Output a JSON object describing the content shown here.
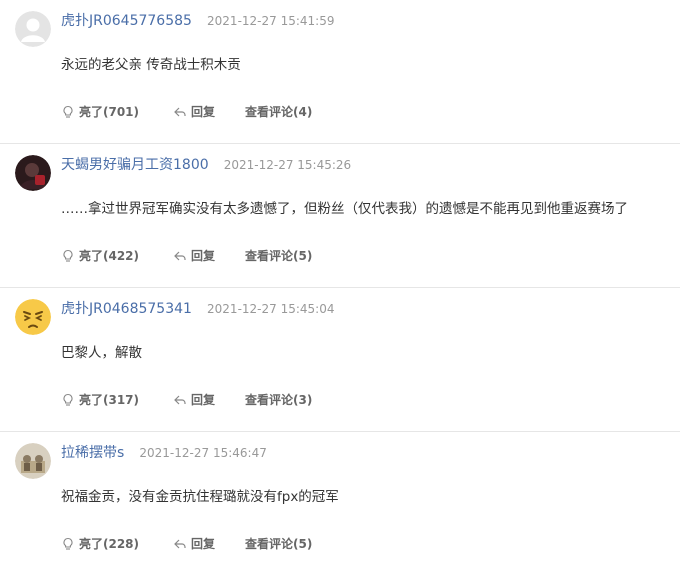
{
  "comments": [
    {
      "username": "虎扑JR0645776585",
      "time": "2021-12-27 15:41:59",
      "content": "永远的老父亲 传奇战士积木贡",
      "like_label": "亮了(701)",
      "reply_label": "回复",
      "view_replies_label": "查看评论(4)",
      "avatar": "default-avatar"
    },
    {
      "username": "天蝎男好骗月工资1800",
      "time": "2021-12-27 15:45:26",
      "content": "……拿过世界冠军确实没有太多遗憾了，但粉丝（仅代表我）的遗憾是不能再见到他重返赛场了",
      "like_label": "亮了(422)",
      "reply_label": "回复",
      "view_replies_label": "查看评论(5)",
      "avatar": "photo-avatar"
    },
    {
      "username": "虎扑JR0468575341",
      "time": "2021-12-27 15:45:04",
      "content": "巴黎人，解散",
      "like_label": "亮了(317)",
      "reply_label": "回复",
      "view_replies_label": "查看评论(3)",
      "avatar": "emoji-face-avatar"
    },
    {
      "username": "拉稀摆带s",
      "time": "2021-12-27 15:46:47",
      "content": "祝福金贡，没有金贡抗住程璐就没有fpx的冠军",
      "like_label": "亮了(228)",
      "reply_label": "回复",
      "view_replies_label": "查看评论(5)",
      "avatar": "photo-avatar"
    }
  ],
  "colors": {
    "username": "#4a6ea8",
    "time": "#999999",
    "divider": "#e6e6e6",
    "action": "#666666"
  }
}
